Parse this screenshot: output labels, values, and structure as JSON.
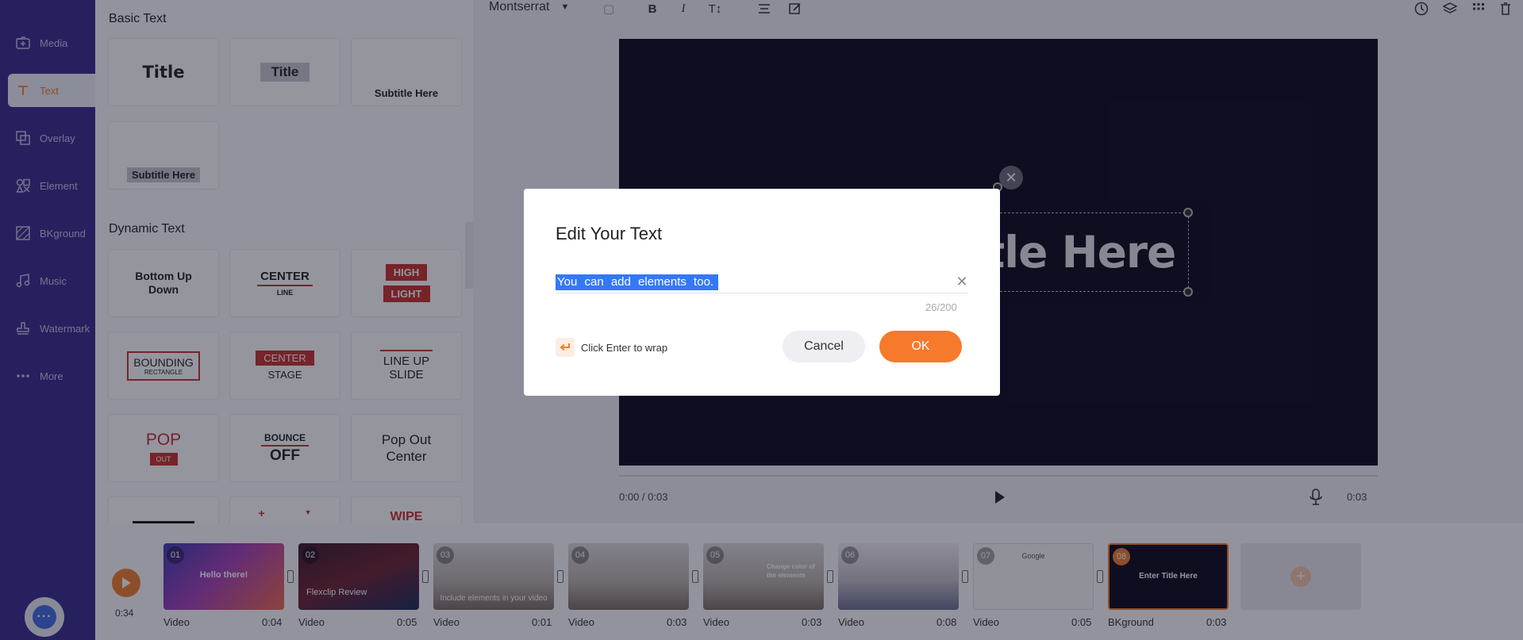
{
  "sidebar": {
    "items": [
      {
        "label": "Media",
        "icon": "media-icon"
      },
      {
        "label": "Text",
        "icon": "text-icon",
        "active": true
      },
      {
        "label": "Overlay",
        "icon": "overlay-icon"
      },
      {
        "label": "Element",
        "icon": "element-icon"
      },
      {
        "label": "BKground",
        "icon": "background-icon"
      },
      {
        "label": "Music",
        "icon": "music-icon"
      },
      {
        "label": "Watermark",
        "icon": "watermark-icon"
      },
      {
        "label": "More",
        "icon": "more-icon"
      }
    ],
    "chat_icon": "chat-icon"
  },
  "panel": {
    "basic_heading": "Basic Text",
    "basic_tiles": [
      "Title",
      "Title",
      "Subtitle Here",
      "Subtitle Here"
    ],
    "dynamic_heading": "Dynamic Text",
    "dynamic_tiles": {
      "bottom_up": "Bottom Up Down",
      "center_line_top": "CENTER",
      "center_line_bottom": "LINE",
      "highlight_top": "HIGH",
      "highlight_bottom": "LIGHT",
      "bounding_top": "BOUNDING",
      "bounding_bottom": "RECTANGLE",
      "center_stage_top": "CENTER",
      "center_stage_bottom": "STAGE",
      "line_up_top": "LINE UP",
      "line_up_bottom": "SLIDE",
      "pop_top": "POP",
      "pop_bottom": "OUT",
      "bounce_top": "BOUNCE",
      "bounce_bottom": "OFF",
      "pop_out_center": "Pop Out Center",
      "wipe": "WIPE"
    }
  },
  "toolbar": {
    "font": "Montserrat"
  },
  "preview": {
    "canvas_text": "tle Here",
    "time_current": "0:00 / 0:03",
    "time_total": "0:03"
  },
  "timeline": {
    "total": "0:34",
    "clips": [
      {
        "num": "01",
        "type": "Video",
        "duration": "0:04",
        "caption": "Hello there!"
      },
      {
        "num": "02",
        "type": "Video",
        "duration": "0:05",
        "caption": "Flexclip Review"
      },
      {
        "num": "03",
        "type": "Video",
        "duration": "0:01",
        "caption": "Include elements in your video"
      },
      {
        "num": "04",
        "type": "Video",
        "duration": "0:03",
        "caption": ""
      },
      {
        "num": "05",
        "type": "Video",
        "duration": "0:03",
        "caption": "Change color of the elements"
      },
      {
        "num": "06",
        "type": "Video",
        "duration": "0:08",
        "caption": ""
      },
      {
        "num": "07",
        "type": "Video",
        "duration": "0:05",
        "caption": "Google"
      },
      {
        "num": "08",
        "type": "BKground",
        "duration": "0:03",
        "caption": "Enter Title Here"
      }
    ]
  },
  "dialog": {
    "title": "Edit Your Text",
    "input_value": "You can add elements too.",
    "counter": "26/200",
    "hint": "Click Enter to wrap",
    "cancel": "Cancel",
    "ok": "OK"
  },
  "colors": {
    "sidebar": "#372a8c",
    "accent": "#f7792b",
    "selection": "#3478f6"
  }
}
